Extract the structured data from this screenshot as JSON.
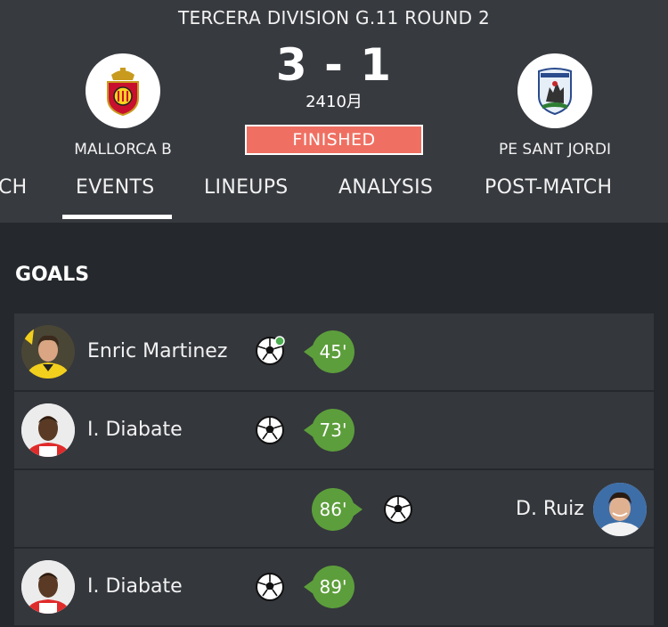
{
  "match": {
    "competition": "TERCERA DIVISION G.11 ROUND 2",
    "score": "3 - 1",
    "subscore": "2410月",
    "status": "FINISHED",
    "home_team": "MALLORCA B",
    "away_team": "PE SANT JORDI"
  },
  "tabs": [
    "CH",
    "EVENTS",
    "LINEUPS",
    "ANALYSIS",
    "POST-MATCH"
  ],
  "active_tab": "EVENTS",
  "goals": {
    "title": "GOALS",
    "events": [
      {
        "side": "home",
        "player": "Enric Martinez",
        "minute": "45'"
      },
      {
        "side": "home",
        "player": "I. Diabate",
        "minute": "73'"
      },
      {
        "side": "away",
        "player": "D. Ruiz",
        "minute": "86'"
      },
      {
        "side": "home",
        "player": "I. Diabate",
        "minute": "89'"
      }
    ]
  },
  "colors": {
    "header_bg": "#373a3f",
    "page_bg": "#25282c",
    "row_bg": "#34373c",
    "finished_badge": "#ef7062",
    "minute_bubble": "#5c9e3b"
  },
  "icons": {
    "home_crest": "mallorca-crest-icon",
    "away_crest": "sant-jordi-crest-icon",
    "goal": "soccer-ball-icon"
  }
}
